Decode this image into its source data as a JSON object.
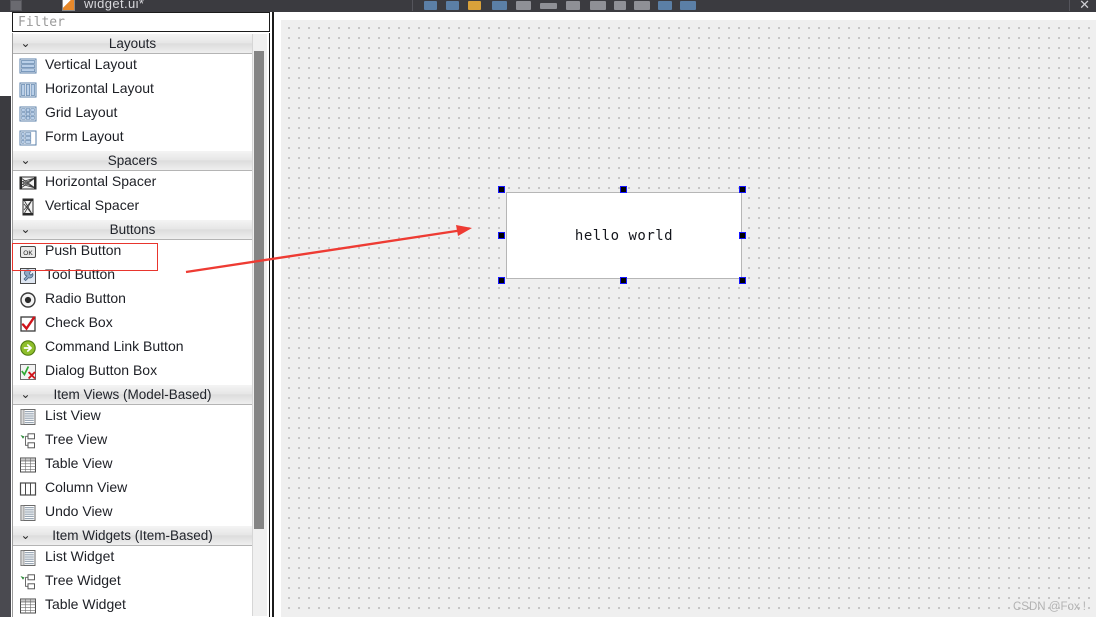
{
  "window": {
    "title": "widget.ui*",
    "close_label": "✕"
  },
  "toolbar": {
    "icons": [
      "form-preview-icon",
      "form-settings-icon",
      "signal-slot-icon",
      "buddy-edit-icon",
      "layout-vertical-icon",
      "layout-horizontal-icon",
      "layout-split-h-icon",
      "layout-split-v-icon",
      "layout-grid-icon",
      "layout-form-icon",
      "break-layout-icon",
      "adjust-size-icon"
    ]
  },
  "search": {
    "placeholder": "Filter",
    "value": ""
  },
  "widget_box": {
    "sections": [
      {
        "id": "layouts",
        "title": "Layouts",
        "expanded": true,
        "items": [
          {
            "label": "Vertical Layout",
            "icon": "layout-vertical-icon"
          },
          {
            "label": "Horizontal Layout",
            "icon": "layout-horizontal-icon"
          },
          {
            "label": "Grid Layout",
            "icon": "layout-grid-icon"
          },
          {
            "label": "Form Layout",
            "icon": "layout-form-icon"
          }
        ]
      },
      {
        "id": "spacers",
        "title": "Spacers",
        "expanded": true,
        "items": [
          {
            "label": "Horizontal Spacer",
            "icon": "spacer-horizontal-icon"
          },
          {
            "label": "Vertical Spacer",
            "icon": "spacer-vertical-icon"
          }
        ]
      },
      {
        "id": "buttons",
        "title": "Buttons",
        "expanded": true,
        "items": [
          {
            "label": "Push Button",
            "icon": "push-button-icon",
            "highlighted": true
          },
          {
            "label": "Tool Button",
            "icon": "tool-button-icon"
          },
          {
            "label": "Radio Button",
            "icon": "radio-button-icon"
          },
          {
            "label": "Check Box",
            "icon": "check-box-icon"
          },
          {
            "label": "Command Link Button",
            "icon": "command-link-icon"
          },
          {
            "label": "Dialog Button Box",
            "icon": "dialog-button-box-icon"
          }
        ]
      },
      {
        "id": "item-views",
        "title": "Item Views (Model-Based)",
        "expanded": true,
        "items": [
          {
            "label": "List View",
            "icon": "list-view-icon"
          },
          {
            "label": "Tree View",
            "icon": "tree-view-icon"
          },
          {
            "label": "Table View",
            "icon": "table-view-icon"
          },
          {
            "label": "Column View",
            "icon": "column-view-icon"
          },
          {
            "label": "Undo View",
            "icon": "undo-view-icon"
          }
        ]
      },
      {
        "id": "item-widgets",
        "title": "Item Widgets (Item-Based)",
        "expanded": true,
        "items": [
          {
            "label": "List Widget",
            "icon": "list-widget-icon"
          },
          {
            "label": "Tree Widget",
            "icon": "tree-widget-icon"
          },
          {
            "label": "Table Widget",
            "icon": "table-widget-icon"
          }
        ]
      }
    ]
  },
  "canvas": {
    "selected_widget": {
      "type": "label",
      "text": "hello world",
      "selected": true
    }
  },
  "annotations": {
    "highlight_target": "Push Button",
    "accent_color": "#e8352d"
  },
  "watermark": "CSDN @Fox !"
}
